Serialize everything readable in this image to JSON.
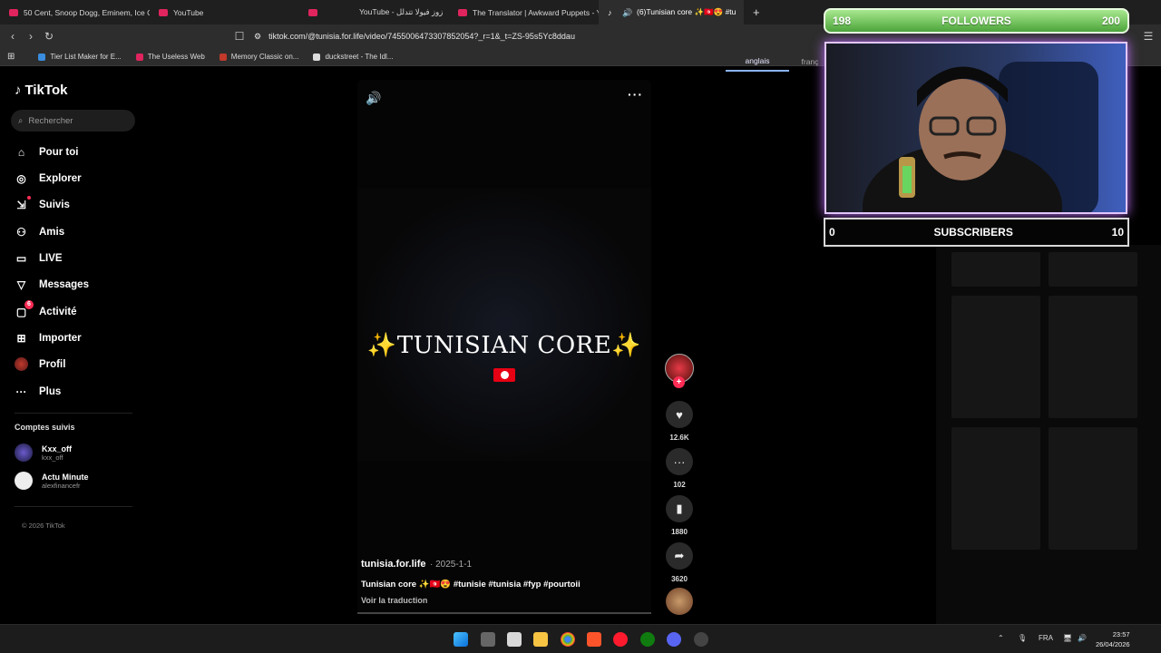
{
  "browser": {
    "tabs": [
      {
        "label": "50 Cent, Snoop Dogg, Eminem, Ice C",
        "favicon": "youtube-icon"
      },
      {
        "label": "YouTube",
        "favicon": "youtube-icon"
      },
      {
        "label": "YouTube - زوز فيولا تتدلل",
        "favicon": "youtube-icon"
      },
      {
        "label": "The Translator | Awkward Puppets - Y",
        "favicon": "youtube-icon"
      },
      {
        "label": "(6)Tunisian core ✨🇹🇳😍 #tu",
        "favicon": "tiktok-icon",
        "active": true
      }
    ],
    "url": "tiktok.com/@tunisia.for.life/video/7455006473307852054?_r=1&_t=ZS-95s5Yc8ddau",
    "bookmarks": [
      {
        "label": "Tier List Maker for E...",
        "color": "#3a8dde"
      },
      {
        "label": "The Useless Web",
        "color": "#e0245e"
      },
      {
        "label": "Memory Classic on...",
        "color": "#c0392b"
      },
      {
        "label": "duckstreet - The Idl...",
        "color": "#ddd"
      }
    ],
    "translate": {
      "active": "anglais",
      "other": "franç"
    }
  },
  "tiktok": {
    "logo": "TikTok",
    "search_placeholder": "Rechercher",
    "nav": [
      {
        "label": "Pour toi",
        "icon": "home-icon"
      },
      {
        "label": "Explorer",
        "icon": "compass-icon"
      },
      {
        "label": "Suivis",
        "icon": "following-icon"
      },
      {
        "label": "Amis",
        "icon": "friends-icon"
      },
      {
        "label": "LIVE",
        "icon": "live-icon"
      },
      {
        "label": "Messages",
        "icon": "messages-icon"
      },
      {
        "label": "Activité",
        "icon": "activity-icon",
        "badge": "6"
      },
      {
        "label": "Importer",
        "icon": "upload-icon"
      },
      {
        "label": "Profil",
        "icon": "profile-avatar"
      },
      {
        "label": "Plus",
        "icon": "more-icon"
      }
    ],
    "following_title": "Comptes suivis",
    "following": [
      {
        "name": "Kxx_off",
        "handle": "kxx_off"
      },
      {
        "name": "Actu Minute",
        "handle": "alexfinancefr"
      }
    ],
    "copyright": "© 2026 TikTok",
    "video": {
      "overlay_title": "✨TUNISIAN CORE✨",
      "username": "tunisia.for.life",
      "date": "· 2025-1-1",
      "caption": "Tunisian core ✨🇹🇳😍 #tunisie #tunisia #fyp #pourtoii",
      "translate_link": "Voir la traduction",
      "likes": "12.6K",
      "comments": "102",
      "saves": "1880",
      "shares": "3620"
    }
  },
  "overlay": {
    "followers_current": "198",
    "followers_label": "FOLLOWERS",
    "followers_goal": "200",
    "subscribers_current": "0",
    "subscribers_label": "SUBSCRIBERS",
    "subscribers_goal": "10"
  },
  "taskbar": {
    "lang": "FRA",
    "time": "23:57",
    "date": "26/04/2026"
  }
}
